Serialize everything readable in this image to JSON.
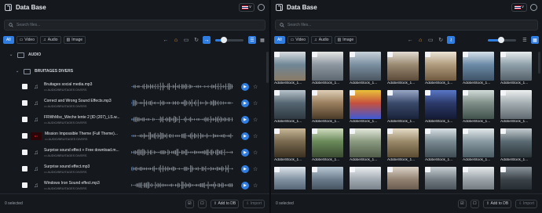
{
  "left": {
    "title": "Data Base",
    "flag_caret": "v",
    "search_placeholder": "Search files...",
    "filters": [
      "All",
      "Video",
      "Audio",
      "Image"
    ],
    "folders": {
      "root": "AUDIO",
      "sub": "BRUITAGES DIVERS"
    },
    "items": [
      {
        "name": "Bruitages social media.mp3",
        "path": "AUDIO/BRUITAGES DIVERS",
        "thumb": "note"
      },
      {
        "name": "Correct and Wrong Sound Effects.mp3",
        "path": "AUDIO/BRUITAGES DIVERS",
        "thumb": "note"
      },
      {
        "name": "FRWhMsc_Weche lente 2 [ID (207)_LS.w...",
        "path": "AUDIO/BRUITAGES DIVERS",
        "thumb": "note"
      },
      {
        "name": "Mission Impossible Theme (Full Theme)...",
        "path": "AUDIO/BRUITAGES DIVERS",
        "thumb": "red"
      },
      {
        "name": "Surprise sound effect + Free download.m...",
        "path": "AUDIO/BRUITAGES DIVERS",
        "thumb": "note"
      },
      {
        "name": "Surprise sound effect.mp3",
        "path": "AUDIO/BRUITAGES DIVERS",
        "thumb": "note"
      },
      {
        "name": "Windows Iron Sound effect.mp3",
        "path": "AUDIO/BRUITAGES DIVERS",
        "thumb": "note"
      }
    ],
    "footer": {
      "selected": "0 selected",
      "add": "Add to DB",
      "import": "Import"
    }
  },
  "right": {
    "title": "Data Base",
    "search_placeholder": "Search files...",
    "filters": [
      "All",
      "Video",
      "Audio",
      "Image"
    ],
    "caption": "AdobeStock_1...",
    "images": [
      [
        "#6f8796",
        "#d9dde0",
        "#8a7a66"
      ],
      [
        "#8d97a0",
        "#e6e7e5",
        "#5d6770"
      ],
      [
        "#7a8fa0",
        "#c9d3da",
        "#4a5560"
      ],
      [
        "#9a8a72",
        "#e3ddd2",
        "#5a4a38"
      ],
      [
        "#b09b7d",
        "#ece5d8",
        "#6f5a40"
      ],
      [
        "#6b8aa6",
        "#d7e2ea",
        "#3e5266"
      ],
      [
        "#8fa0aa",
        "#e8eced",
        "#55606a"
      ],
      [
        "#556672",
        "#b8c4cc",
        "#2e3840"
      ],
      [
        "#9a7f5e",
        "#e0d0b8",
        "#4a3a28"
      ],
      [
        "#c6503e",
        "#e9c23a",
        "#3c5ad8"
      ],
      [
        "#3a4a6a",
        "#9aa8c8",
        "#1a223a"
      ],
      [
        "#2c3a6a",
        "#5a78c8",
        "#141a34"
      ],
      [
        "#7f8e88",
        "#d2dcd8",
        "#40504a"
      ],
      [
        "#a4aeb2",
        "#eef0f0",
        "#606a70"
      ],
      [
        "#7a6a50",
        "#c8b898",
        "#3a3020"
      ],
      [
        "#6a8a5a",
        "#d0dcc0",
        "#3a4a30"
      ],
      [
        "#8a9a80",
        "#e4e8dc",
        "#505a48"
      ],
      [
        "#9a8a6a",
        "#e6ddc8",
        "#5a4a30"
      ],
      [
        "#7a8a92",
        "#d8e0e4",
        "#3e4a52"
      ],
      [
        "#8a9aa2",
        "#e2e8ea",
        "#4a5a62"
      ],
      [
        "#5a6a72",
        "#c4ccd0",
        "#2a3438"
      ],
      [
        "#8090a0",
        "#dce4ea",
        "#3a4a5a"
      ],
      [
        "#6a7a8a",
        "#b8c8d4",
        "#2e3a46"
      ],
      [
        "#a0a8b0",
        "#eaeef0",
        "#606a72"
      ],
      [
        "#908070",
        "#dcd4c8",
        "#50443a"
      ],
      [
        "#707a80",
        "#c8d0d4",
        "#343c42"
      ],
      [
        "#9aa2a8",
        "#e4e8ea",
        "#5a6268"
      ],
      [
        "#3a4248",
        "#8a949a",
        "#1a2024"
      ]
    ],
    "footer": {
      "selected": "0 selected",
      "add": "Add to DB",
      "import": "Import"
    }
  }
}
